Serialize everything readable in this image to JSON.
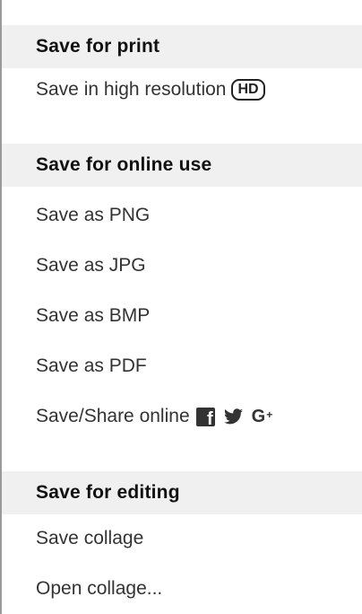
{
  "sections": [
    {
      "title": "Save for print",
      "items": [
        {
          "label": "Save in high resolution",
          "badge": "HD"
        }
      ]
    },
    {
      "title": "Save for online use",
      "items": [
        {
          "label": "Save as PNG"
        },
        {
          "label": "Save as JPG"
        },
        {
          "label": "Save as BMP"
        },
        {
          "label": "Save as PDF"
        },
        {
          "label": "Save/Share online",
          "icons": [
            "facebook-icon",
            "twitter-icon",
            "google-plus-icon"
          ]
        }
      ]
    },
    {
      "title": "Save for editing",
      "items": [
        {
          "label": "Save collage"
        },
        {
          "label": "Open collage..."
        }
      ]
    }
  ],
  "colors": {
    "header_bg": "#f0f0f0",
    "item_text": "#333333",
    "header_text": "#111111",
    "left_border": "#9a9a9a"
  }
}
